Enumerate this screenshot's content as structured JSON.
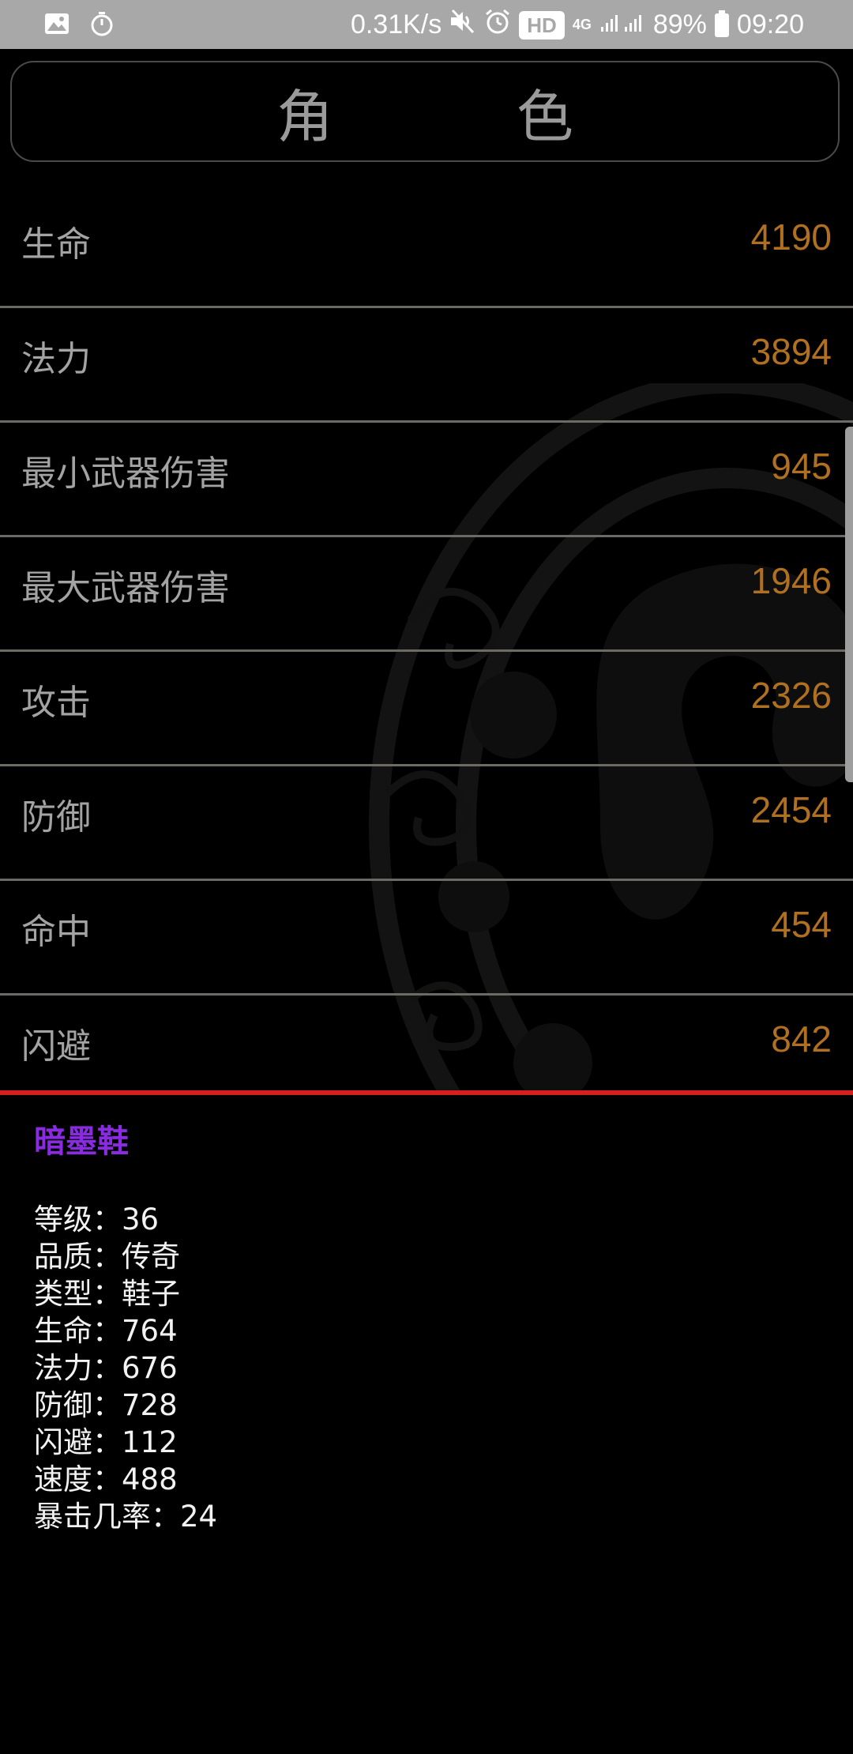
{
  "status_bar": {
    "net_speed": "0.31K/s",
    "hd": "HD",
    "network": "4G",
    "battery": "89%",
    "time": "09:20",
    "icons": [
      "gallery-icon",
      "timer-icon",
      "mute-icon",
      "alarm-icon",
      "signal-icon",
      "battery-icon"
    ]
  },
  "header": {
    "title": "角　色"
  },
  "stats": [
    {
      "label": "生命",
      "value": "4190"
    },
    {
      "label": "法力",
      "value": "3894"
    },
    {
      "label": "最小武器伤害",
      "value": "945"
    },
    {
      "label": "最大武器伤害",
      "value": "1946"
    },
    {
      "label": "攻击",
      "value": "2326"
    },
    {
      "label": "防御",
      "value": "2454"
    },
    {
      "label": "命中",
      "value": "454"
    },
    {
      "label": "闪避",
      "value": "842"
    }
  ],
  "item": {
    "name": "暗墨鞋",
    "attributes": [
      "等级：36",
      "品质：传奇",
      "类型：鞋子",
      "生命：764",
      "法力：676",
      "防御：728",
      "闪避：112",
      "速度：488",
      "暴击几率：24"
    ]
  },
  "colors": {
    "value": "#b0701f",
    "item_name": "#8a2be2",
    "divider_red": "#d42020"
  }
}
